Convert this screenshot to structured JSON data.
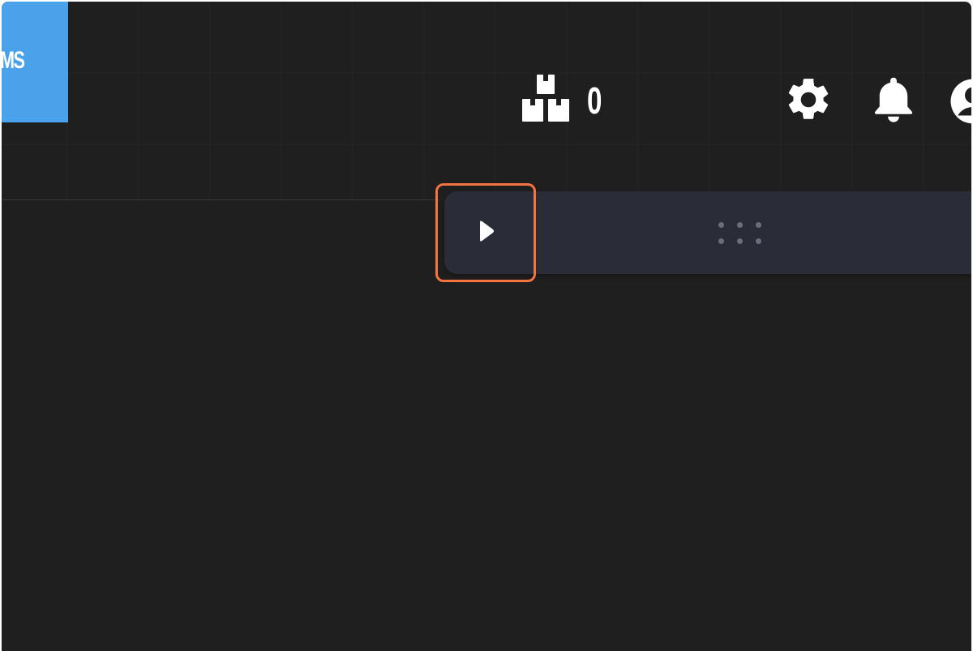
{
  "header": {
    "logo_text": "MS",
    "inventory_icon": "stacked-boxes-icon",
    "inventory_count": "0",
    "settings_icon": "gear-icon",
    "notifications_icon": "bell-icon",
    "profile_icon": "user-avatar-icon"
  },
  "toolbar": {
    "play_icon": "play-icon",
    "drag_handle_icon": "drag-grip-icon"
  },
  "colors": {
    "background": "#1f1f1f",
    "logo_tile": "#4aa3ea",
    "toolbar": "#2a2d38",
    "highlight": "#f47340"
  }
}
